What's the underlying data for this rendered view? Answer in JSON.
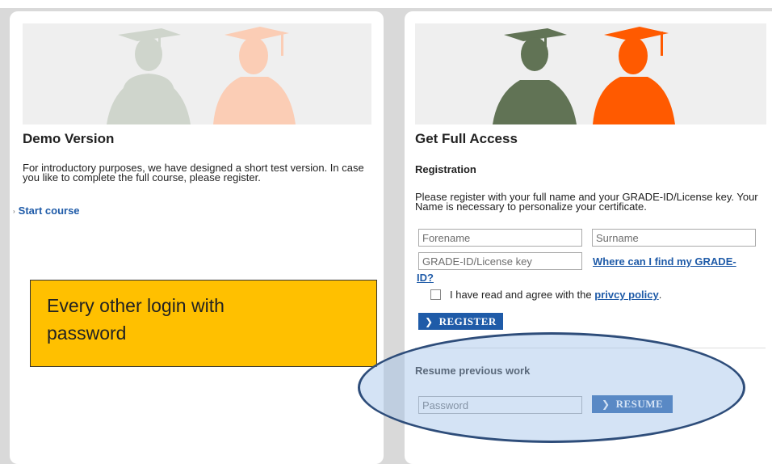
{
  "demo": {
    "title": "Demo Version",
    "description": "For introductory purposes, we have designed a short test version. In case you like to complete the full course, please register.",
    "start_link": "Start course",
    "colors": {
      "silhouette_back": "#cfd5cc",
      "silhouette_front": "#fbcdb5"
    }
  },
  "full": {
    "title": "Get Full Access",
    "registration_heading": "Registration",
    "registration_text": "Please register with your full name and your GRADE-ID/License key. Your Name is necessary to personalize your certificate.",
    "forename_placeholder": "Forename",
    "surname_placeholder": "Surname",
    "license_placeholder": "GRADE-ID/License key",
    "find_id_link": "Where can I find my GRADE-ID?",
    "agree_text": "I have read and agree with the ",
    "policy_link": "privcy policy",
    "agree_suffix": ".",
    "register_button": "REGISTER",
    "resume_heading": "Resume previous work",
    "password_placeholder": "Password",
    "resume_button": "RESUME",
    "colors": {
      "silhouette_back": "#617355",
      "silhouette_front": "#ff5a00",
      "link": "#1f5ba8",
      "button": "#1f5ba8"
    }
  },
  "callout": {
    "text": "Every other login with password",
    "color": "#ffc000"
  }
}
